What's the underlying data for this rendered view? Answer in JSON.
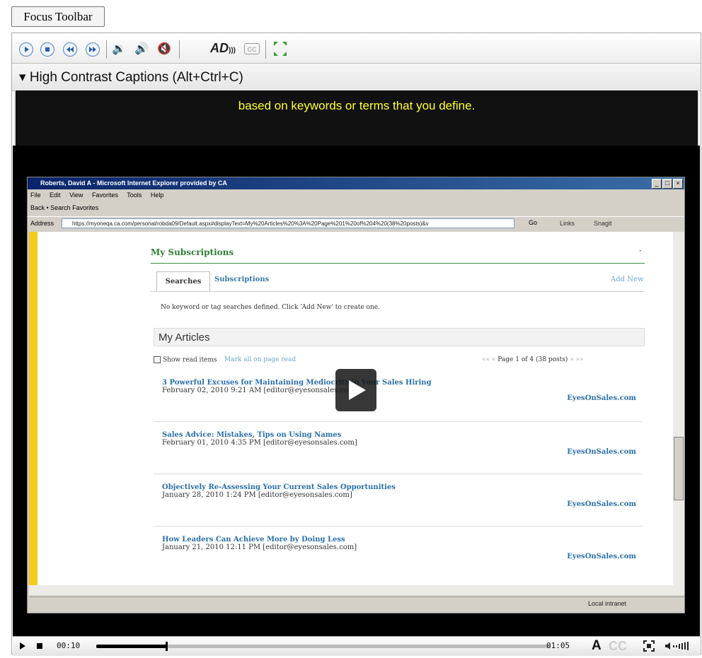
{
  "focus_toolbar_label": "Focus Toolbar",
  "toolbar": {
    "buttons": [
      "play-icon",
      "stop-icon",
      "rewind-icon",
      "fast-forward-icon",
      "volume-down-icon",
      "volume-up-icon",
      "mute-icon",
      "audio-description-icon",
      "closed-captions-icon",
      "resize-icon"
    ],
    "ad_label": "AD",
    "cc_label": "CC"
  },
  "captions": {
    "header": "▾ High Contrast Captions (Alt+Ctrl+C)",
    "text": "based on keywords or terms that you define."
  },
  "browser": {
    "title": "Roberts, David A - Microsoft Internet Explorer provided by CA",
    "menu": [
      "File",
      "Edit",
      "View",
      "Favorites",
      "Tools",
      "Help"
    ],
    "tools": "Back  •  Search  Favorites",
    "address_label": "Address",
    "address_value": "https://myoneqa.ca.com/personal/robda09/Default.aspx#displayText=My%20Articles%20%3A%20Page%201%20of%204%20(38%20posts)&v",
    "go": "Go",
    "links": "Links",
    "snagit": "Snagit",
    "status_zone": "Local intranet"
  },
  "page": {
    "subscriptions_title": "My Subscriptions",
    "tabs": [
      {
        "label": "Searches"
      },
      {
        "label": "Subscriptions"
      }
    ],
    "add_new": "Add New",
    "no_keyword": "No keyword or tag searches defined. Click 'Add New' to create one.",
    "articles_title": "My Articles",
    "show_read": "Show read items",
    "mark_all": "Mark all on page read",
    "pager_prev": "««   «",
    "pager_text": "Page 1 of 4 (38 posts)",
    "pager_next": "»   »»",
    "articles": [
      {
        "title": "3 Powerful Excuses for Maintaining Mediocrity in Your Sales Hiring",
        "date": "February 02, 2010 9:21 AM  [editor@eyesonsales.com]",
        "source": "EyesOnSales.com"
      },
      {
        "title": "Sales Advice: Mistakes, Tips on Using Names",
        "date": "February 01, 2010 4:35 PM  [editor@eyesonsales.com]",
        "source": "EyesOnSales.com"
      },
      {
        "title": "Objectively Re-Assessing Your Current Sales Opportunities",
        "date": "January 28, 2010 1:24 PM  [editor@eyesonsales.com]",
        "source": "EyesOnSales.com"
      },
      {
        "title": "How Leaders Can Achieve More by Doing Less",
        "date": "January 21, 2010 12:11 PM  [editor@eyesonsales.com]",
        "source": "EyesOnSales.com"
      }
    ]
  },
  "controls": {
    "elapsed": "00:10",
    "total": "01:05",
    "progress": 0.154,
    "caption_a": "A",
    "caption_cc": "CC"
  }
}
